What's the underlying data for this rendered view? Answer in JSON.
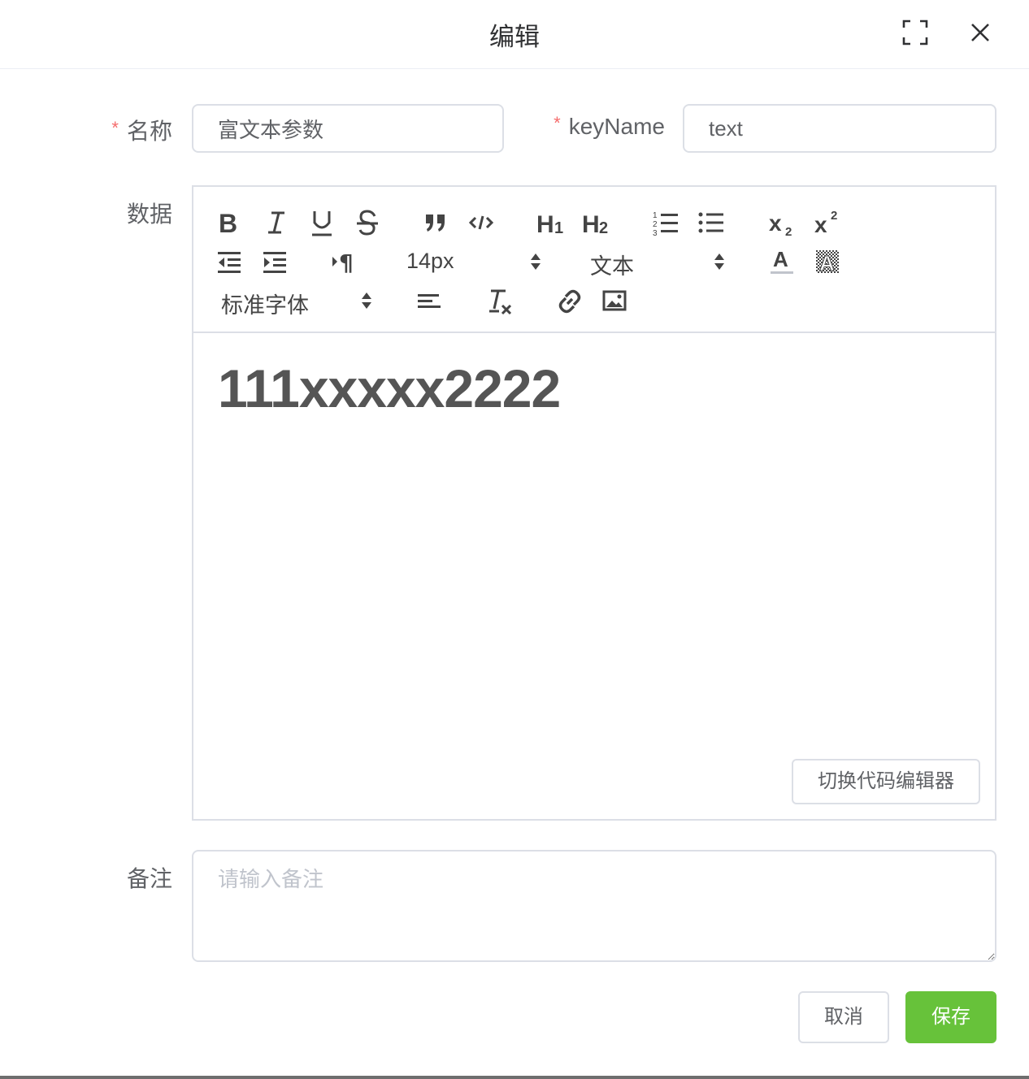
{
  "dialog": {
    "title": "编辑",
    "fullscreen_icon": "fullscreen-icon",
    "close_icon": "close-icon"
  },
  "form": {
    "name_label": "名称",
    "name_value": "富文本参数",
    "keyname_label": "keyName",
    "keyname_value": "text",
    "required_mark": "*",
    "data_label": "数据",
    "remark_label": "备注",
    "remark_placeholder": "请输入备注"
  },
  "editor": {
    "toolbar": {
      "font_size": "14px",
      "header": "文本",
      "font_family": "标准字体",
      "icons": [
        "bold-icon",
        "italic-icon",
        "underline-icon",
        "strike-icon",
        "blockquote-icon",
        "code-block-icon",
        "h1-icon",
        "h2-icon",
        "ordered-list-icon",
        "bullet-list-icon",
        "subscript-icon",
        "superscript-icon",
        "outdent-icon",
        "indent-icon",
        "rtl-icon",
        "font-color-icon",
        "background-color-icon",
        "align-icon",
        "clean-format-icon",
        "link-icon",
        "image-icon"
      ]
    },
    "content": "111xxxxx2222",
    "switch_button": "切换代码编辑器"
  },
  "footer": {
    "cancel": "取消",
    "save": "保存"
  },
  "colors": {
    "primary_green": "#67c23a",
    "required_red": "#f56c6c",
    "border": "#dcdfe6"
  }
}
